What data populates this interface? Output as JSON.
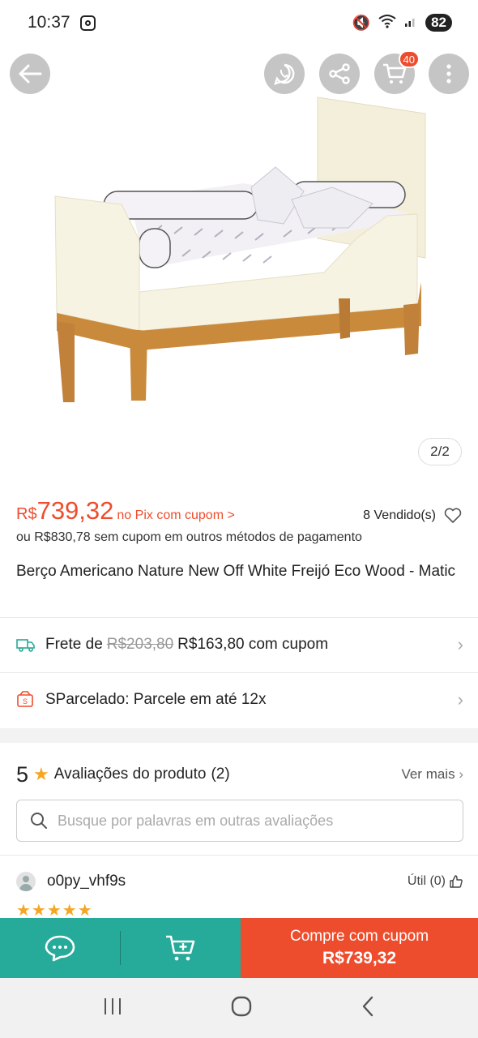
{
  "status_bar": {
    "time": "10:37",
    "battery": "82"
  },
  "header": {
    "cart_count": "40"
  },
  "hero": {
    "page_indicator": "2/2"
  },
  "product": {
    "currency": "R$",
    "price": "739,32",
    "pix_link": "no Pix com cupom >",
    "sold": "8 Vendido(s)",
    "alt_price": "ou R$830,78 sem cupom em outros métodos de pagamento",
    "title": "Berço Americano Nature New Off White Freijó Eco Wood - Matic"
  },
  "shipping": {
    "prefix": "Frete de",
    "old_price": "R$203,80",
    "new_price": "R$163,80 com cupom"
  },
  "installments": {
    "label": "SParcelado: Parcele em até 12x"
  },
  "reviews": {
    "rating": "5",
    "title": "Avaliações do produto",
    "count": "(2)",
    "see_more": "Ver mais",
    "search_placeholder": "Busque por palavras em outras avaliações",
    "first_review": {
      "user": "o0py_vhf9s",
      "useful": "Útil (0)",
      "stars": "★★★★★",
      "rating": 5
    }
  },
  "bottom_bar": {
    "buy_line1": "Compre com cupom",
    "buy_line2": "R$739,32"
  },
  "colors": {
    "accent": "#ee4d2d",
    "teal": "#26aa99",
    "star": "#f5a623"
  }
}
